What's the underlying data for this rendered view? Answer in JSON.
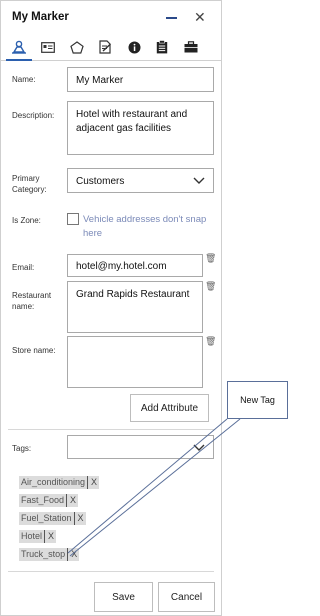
{
  "window": {
    "title": "My Marker",
    "minimize_icon": "minimize-icon",
    "close_glyph": "✕"
  },
  "toolbar": {
    "icons": [
      "person-pin-icon",
      "id-card-icon",
      "pentagon-icon",
      "document-edit-icon",
      "info-icon",
      "clipboard-icon",
      "briefcase-icon"
    ],
    "active_index": 0
  },
  "form": {
    "name_label": "Name:",
    "name_value": "My Marker",
    "description_label": "Description:",
    "description_value_line1": "Hotel with restaurant and",
    "description_value_line2": "adjacent gas facilities",
    "primary_category_label_line1": "Primary",
    "primary_category_label_line2": "Category:",
    "primary_category_value": "Customers",
    "is_zone_label": "Is Zone:",
    "is_zone_text_line1": "Vehicle addresses don't snap",
    "is_zone_text_line2": "here",
    "email_label": "Email:",
    "email_value": "hotel@my.hotel.com",
    "restaurant_label_line1": "Restaurant",
    "restaurant_label_line2": "name:",
    "restaurant_value": "Grand Rapids Restaurant",
    "store_label": "Store name:",
    "store_value": "",
    "add_attribute_label": "Add Attribute",
    "tags_label": "Tags:"
  },
  "tags": [
    "Air_conditioning",
    "Fast_Food",
    "Fuel_Station",
    "Hotel",
    "Truck_stop"
  ],
  "tag_remove_label": "X",
  "footer": {
    "save_label": "Save",
    "cancel_label": "Cancel"
  },
  "callout": {
    "text": "New Tag"
  },
  "colors": {
    "accent": "#2b5fae",
    "zone_text": "#7b8ab8",
    "tag_bg": "#dcdcdc"
  }
}
